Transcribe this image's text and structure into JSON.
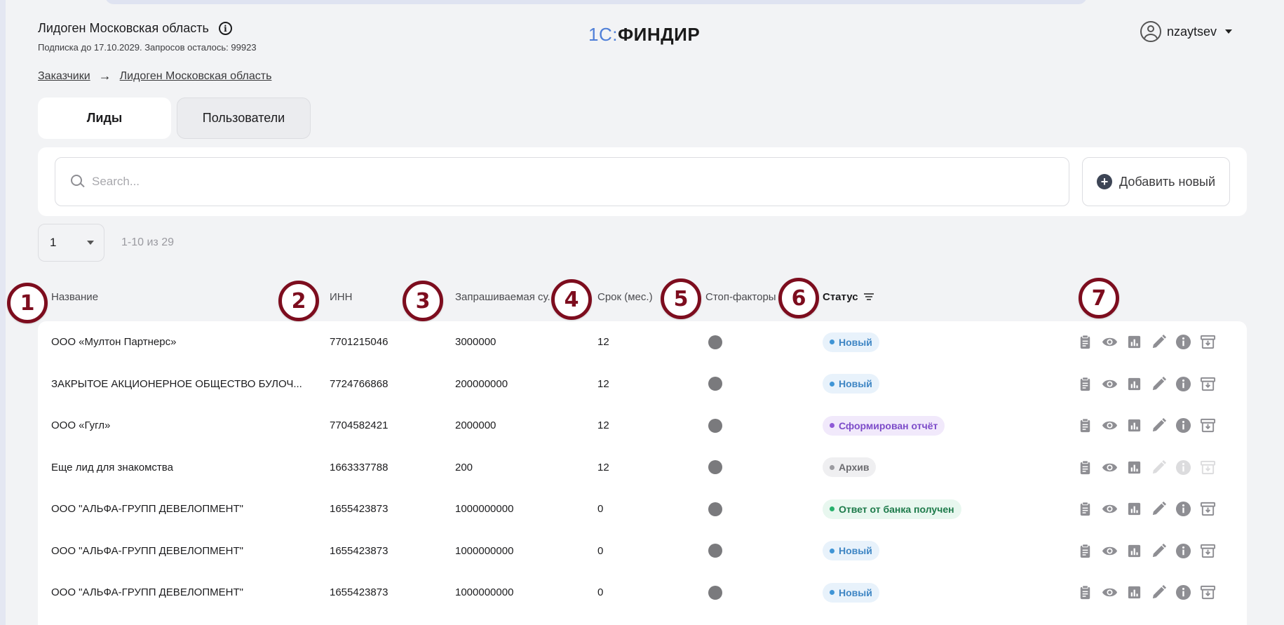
{
  "header": {
    "org_title": "Лидоген Московская область",
    "subscription": "Подписка до 17.10.2029. Запросов осталось: 99923",
    "logo_part1": "1С:",
    "logo_part2": "ФИНДИР",
    "username": "nzaytsev"
  },
  "breadcrumb": {
    "items": [
      "Заказчики",
      "Лидоген Московская область"
    ],
    "separator": "→"
  },
  "tabs": [
    {
      "label": "Лиды",
      "active": true
    },
    {
      "label": "Пользователи",
      "active": false
    }
  ],
  "search": {
    "placeholder": "Search...",
    "value": ""
  },
  "add_button": {
    "label": "Добавить новый"
  },
  "pager": {
    "page": "1",
    "range": "1-10 из 29"
  },
  "columns": {
    "name": "Название",
    "inn": "ИНН",
    "amount": "Запрашиваемая су...",
    "term": "Срок (мес.)",
    "stop": "Стоп-факторы",
    "status": "Статус"
  },
  "markers": [
    "1",
    "2",
    "3",
    "4",
    "5",
    "6",
    "7"
  ],
  "status_colors": {
    "new": {
      "bg": "#e8f2fb",
      "fg": "#3f86c4",
      "dot": "#3f95d6"
    },
    "report": {
      "bg": "#f1e9fb",
      "fg": "#7d4cc9",
      "dot": "#8f5ad6"
    },
    "archive": {
      "bg": "#efeff1",
      "fg": "#6c6c70",
      "dot": "#9c9ca1"
    },
    "bank": {
      "bg": "#e8f7ef",
      "fg": "#1d7a4a",
      "dot": "#27b06c"
    }
  },
  "rows": [
    {
      "name": "ООО «Мултон Партнерс»",
      "inn": "7701215046",
      "amount": "3000000",
      "term": "12",
      "status": "Новый",
      "status_kind": "new",
      "actions_disabled": false
    },
    {
      "name": "ЗАКРЫТОЕ АКЦИОНЕРНОЕ ОБЩЕСТВО БУЛОЧ...",
      "inn": "7724766868",
      "amount": "200000000",
      "term": "12",
      "status": "Новый",
      "status_kind": "new",
      "actions_disabled": false
    },
    {
      "name": "ООО «Гугл»",
      "inn": "7704582421",
      "amount": "2000000",
      "term": "12",
      "status": "Сформирован отчёт",
      "status_kind": "report",
      "actions_disabled": false
    },
    {
      "name": "Еще лид для знакомства",
      "inn": "1663337788",
      "amount": "200",
      "term": "12",
      "status": "Архив",
      "status_kind": "archive",
      "actions_disabled": true
    },
    {
      "name": "ООО \"АЛЬФА-ГРУПП ДЕВЕЛОПМЕНТ\"",
      "inn": "1655423873",
      "amount": "1000000000",
      "term": "0",
      "status": "Ответ от банка получен",
      "status_kind": "bank",
      "actions_disabled": false
    },
    {
      "name": "ООО \"АЛЬФА-ГРУПП ДЕВЕЛОПМЕНТ\"",
      "inn": "1655423873",
      "amount": "1000000000",
      "term": "0",
      "status": "Новый",
      "status_kind": "new",
      "actions_disabled": false
    },
    {
      "name": "ООО \"АЛЬФА-ГРУПП ДЕВЕЛОПМЕНТ\"",
      "inn": "1655423873",
      "amount": "1000000000",
      "term": "0",
      "status": "Новый",
      "status_kind": "new",
      "actions_disabled": false
    }
  ],
  "row_actions": [
    "clipboard-icon",
    "eye-icon",
    "chart-icon",
    "pencil-icon",
    "info-icon",
    "archive-icon"
  ]
}
